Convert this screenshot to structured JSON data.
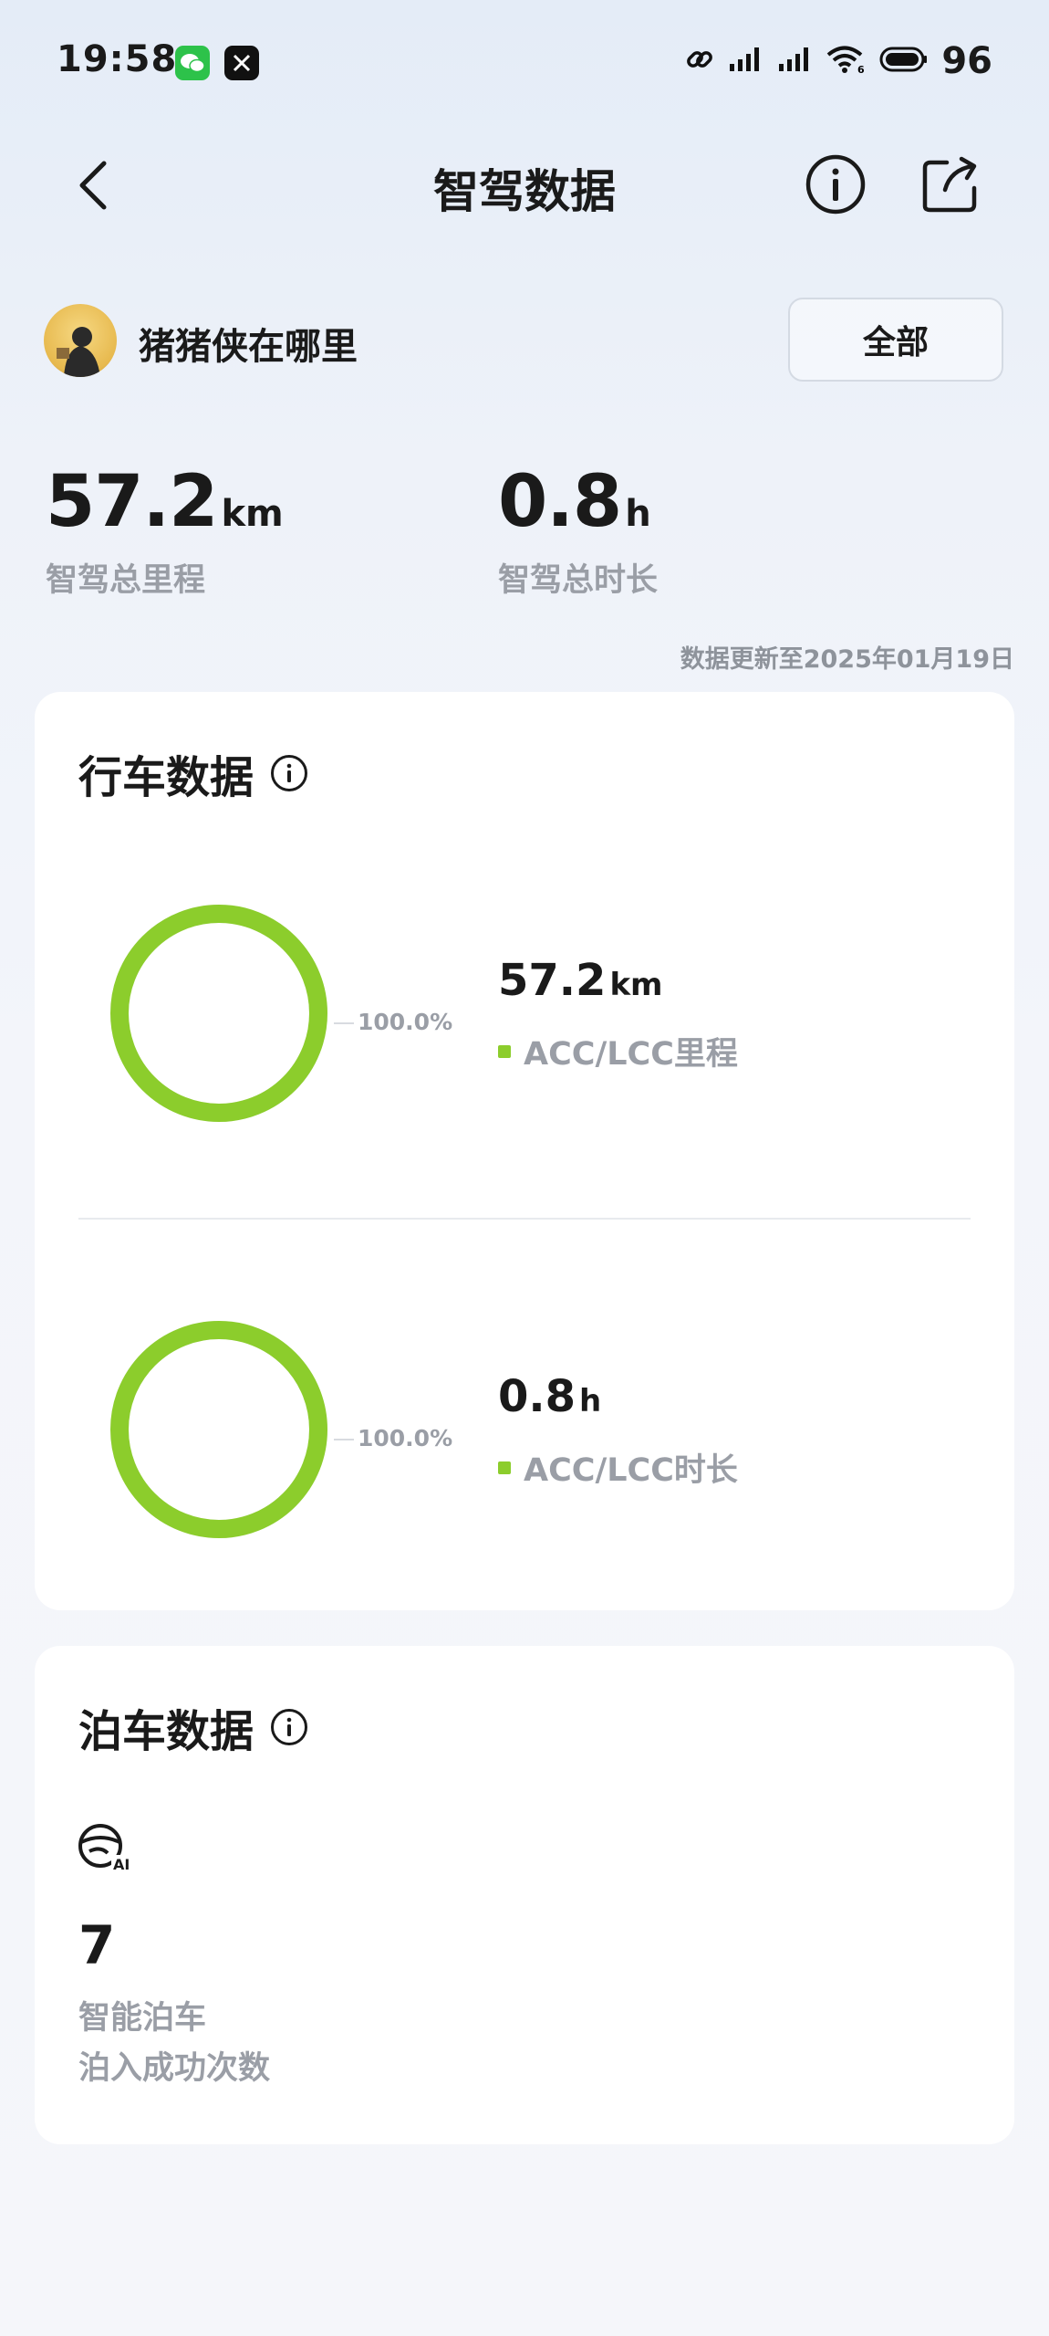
{
  "status_bar": {
    "time": "19:58",
    "battery": "96",
    "icons": [
      "wechat-icon",
      "x-app-icon",
      "link-icon",
      "signal-icon",
      "signal-icon",
      "wifi-icon",
      "battery-icon"
    ]
  },
  "header": {
    "title": "智驾数据",
    "icons": [
      "back-icon",
      "info-icon",
      "share-icon"
    ]
  },
  "user": {
    "name": "猪猪侠在哪里",
    "filter_label": "全部"
  },
  "summary": {
    "mileage_value": "57.2",
    "mileage_unit": "km",
    "mileage_label": "智驾总里程",
    "duration_value": "0.8",
    "duration_unit": "h",
    "duration_label": "智驾总时长",
    "updated_text": "数据更新至2025年01月19日"
  },
  "driving": {
    "title": "行车数据",
    "mileage_ring": {
      "percent_label": "100.0%",
      "percent": 100.0,
      "value": "57.2",
      "unit": "km",
      "legend": "ACC/LCC里程"
    },
    "duration_ring": {
      "percent_label": "100.0%",
      "percent": 100.0,
      "value": "0.8",
      "unit": "h",
      "legend": "ACC/LCC时长"
    }
  },
  "parking": {
    "title": "泊车数据",
    "count": "7",
    "label_line1": "智能泊车",
    "label_line2": "泊入成功次数",
    "icon": "ai-steering-icon"
  },
  "colors": {
    "accent_green": "#8ccd2c",
    "muted_text": "#9a9ea6",
    "card_bg": "#ffffff"
  }
}
